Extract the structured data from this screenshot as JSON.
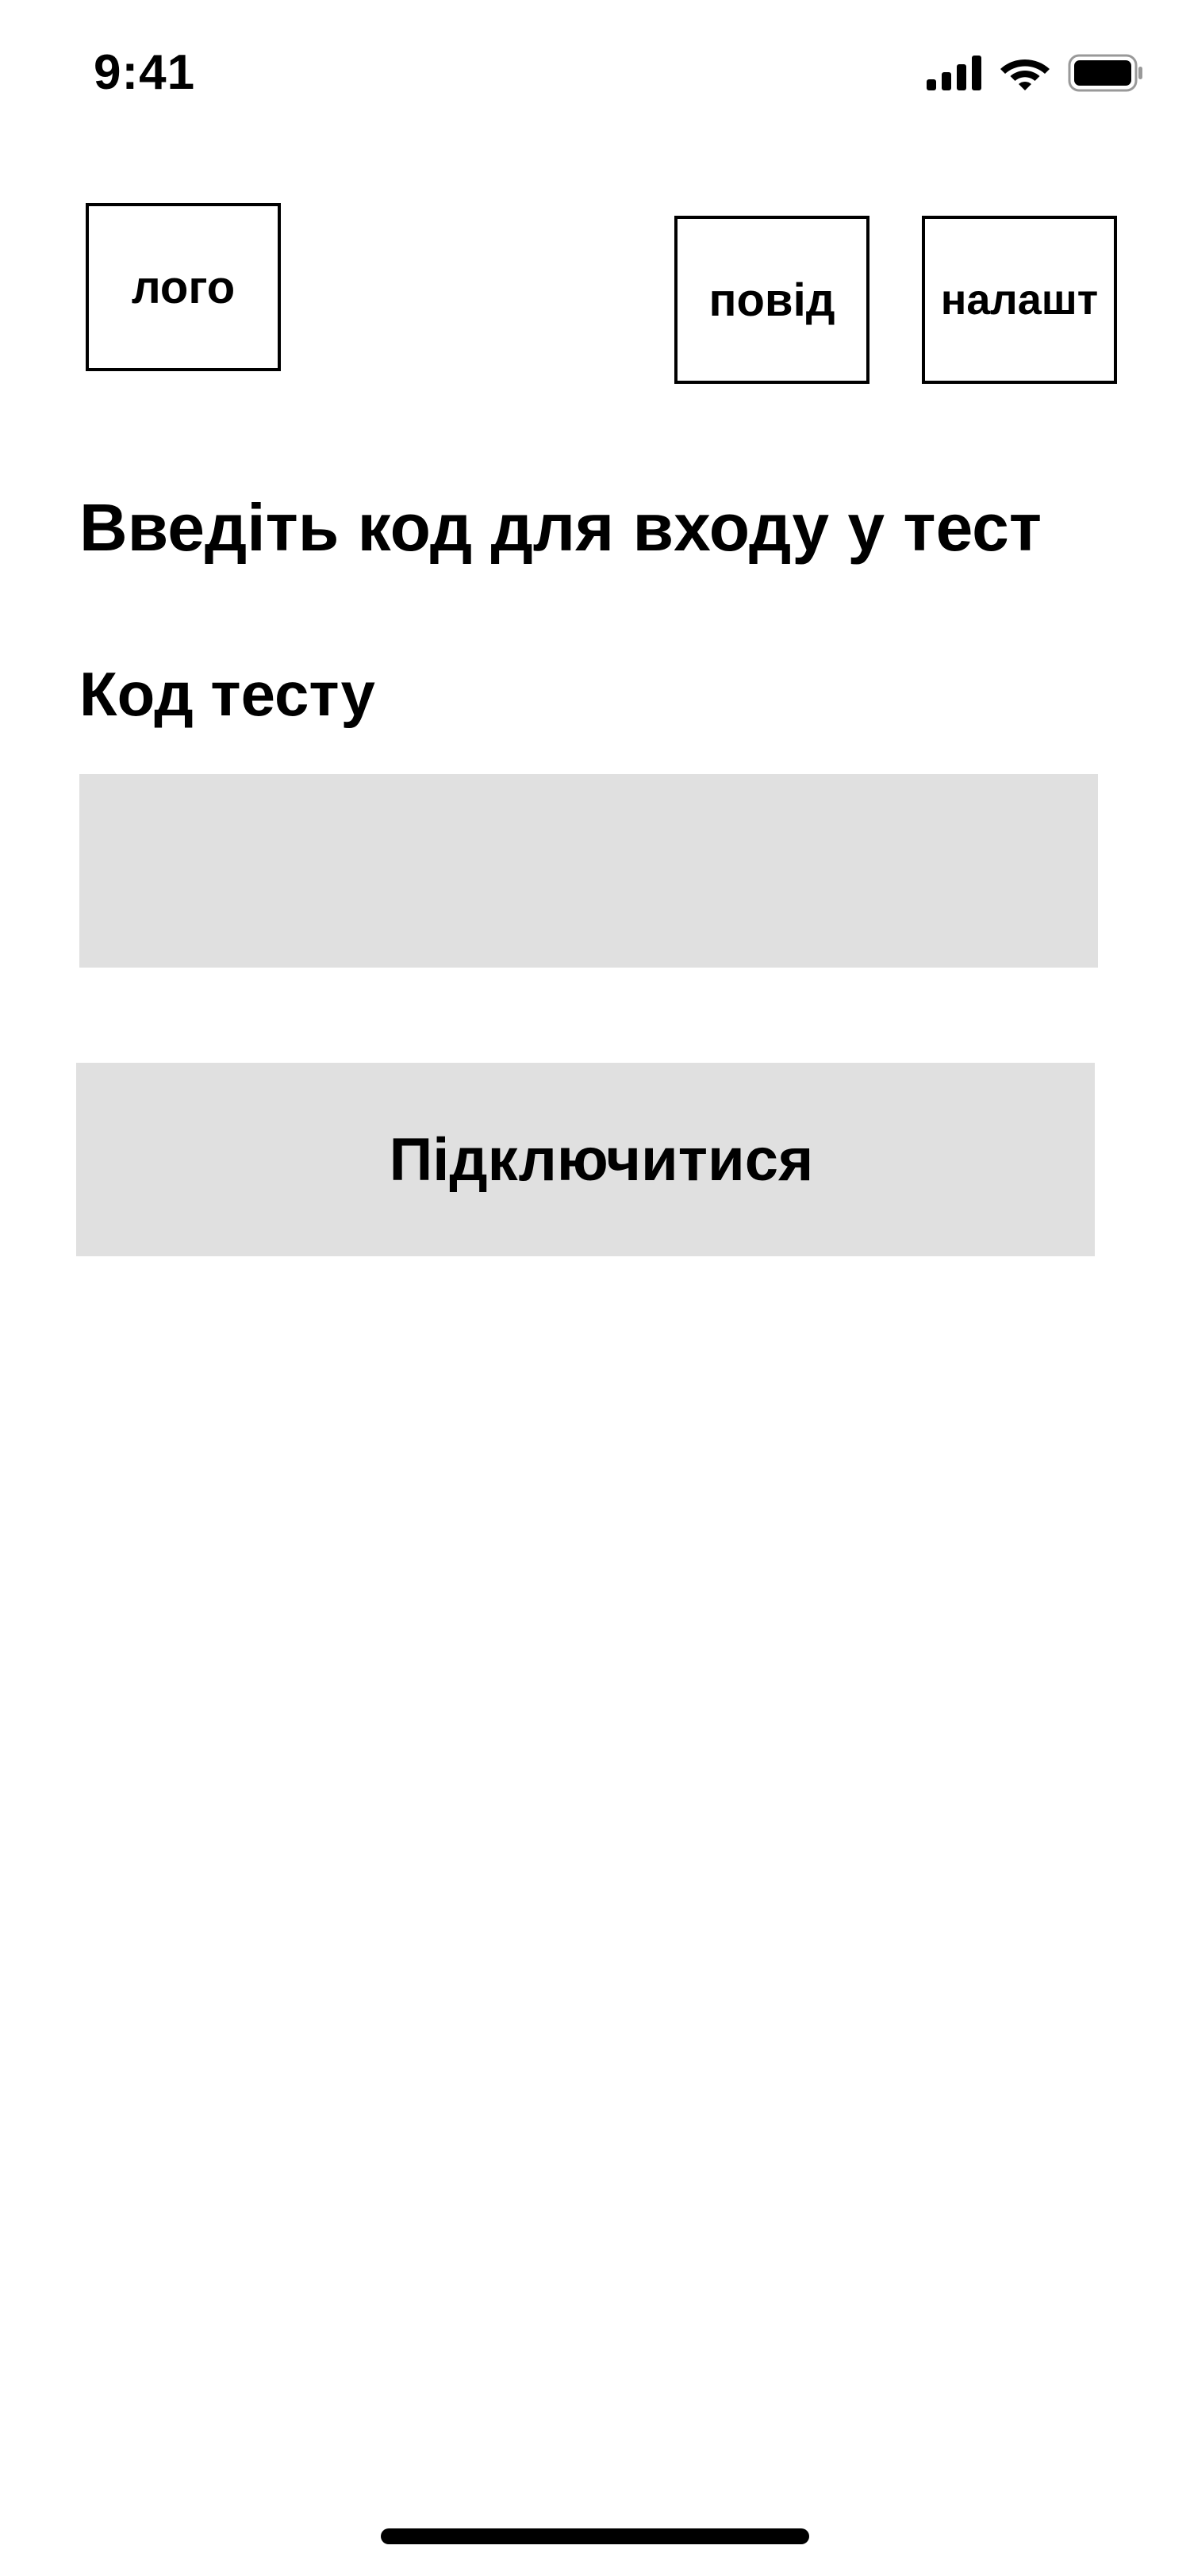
{
  "status_bar": {
    "time": "9:41",
    "icons": [
      "signal-icon",
      "wifi-icon",
      "battery-icon"
    ]
  },
  "header": {
    "logo_label": "лого",
    "notifications_label": "повід",
    "settings_label": "налашт"
  },
  "main": {
    "heading": "Введіть код для входу у тест",
    "code_label": "Код тесту",
    "code_input_value": "",
    "code_input_placeholder": "",
    "connect_label": "Підключитися"
  },
  "colors": {
    "input_background": "#e0e0e0",
    "button_background": "#e0e0e0",
    "text": "#000000",
    "background": "#ffffff"
  }
}
